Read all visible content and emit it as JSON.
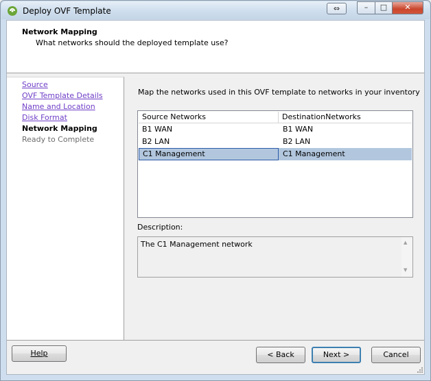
{
  "window": {
    "title": "Deploy OVF Template",
    "controls": {
      "extra": "⇔",
      "minimize": "–",
      "maximize": "□",
      "close": "✕"
    }
  },
  "header": {
    "title": "Network Mapping",
    "subtitle": "What networks should the deployed template use?"
  },
  "steps": [
    {
      "label": "Source",
      "state": "completed"
    },
    {
      "label": "OVF Template Details",
      "state": "completed"
    },
    {
      "label": "Name and Location",
      "state": "completed"
    },
    {
      "label": "Disk Format",
      "state": "completed"
    },
    {
      "label": "Network Mapping",
      "state": "current"
    },
    {
      "label": "Ready to Complete",
      "state": "pending"
    }
  ],
  "main": {
    "instruction": "Map the networks used in this OVF template to networks in your inventory",
    "table": {
      "headers": [
        "Source Networks",
        "DestinationNetworks"
      ],
      "rows": [
        [
          "B1 WAN",
          "B1 WAN"
        ],
        [
          "B2 LAN",
          "B2 LAN"
        ],
        [
          "C1 Management",
          "C1 Management"
        ]
      ],
      "selected_row": 2
    },
    "description_label": "Description:",
    "description_text": "The C1 Management network"
  },
  "buttons": {
    "help": "Help",
    "back": "< Back",
    "next": "Next >",
    "cancel": "Cancel"
  },
  "colors": {
    "link": "#6f3ec7",
    "selection": "#b2c7de",
    "default_button_border": "#3c7fb1"
  }
}
